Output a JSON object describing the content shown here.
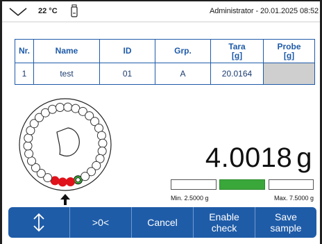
{
  "statusbar": {
    "temperature": "22 °C",
    "user_info": "Administrator - 20.01.2025 08:52"
  },
  "table": {
    "headers": [
      {
        "line1": "Nr.",
        "line2": ""
      },
      {
        "line1": "Name",
        "line2": ""
      },
      {
        "line1": "ID",
        "line2": ""
      },
      {
        "line1": "Grp.",
        "line2": ""
      },
      {
        "line1": "Tara",
        "line2": "[g]"
      },
      {
        "line1": "Probe",
        "line2": "[g]"
      }
    ],
    "rows": [
      {
        "nr": "1",
        "name": "test",
        "id": "01",
        "grp": "A",
        "tara": "20.0164",
        "probe": ""
      }
    ]
  },
  "weight": {
    "value": "4.0018",
    "unit": "g"
  },
  "tolerance": {
    "min_label": "Min. 2.5000 g",
    "max_label": "Max. 7.5000 g",
    "status": "within"
  },
  "toolbar": {
    "scroll_icon": "up-down-arrow-icon",
    "zero_label": ">0<",
    "cancel_label": "Cancel",
    "enable_check_line1": "Enable",
    "enable_check_line2": "check",
    "save_sample_line1": "Save",
    "save_sample_line2": "sample"
  },
  "rotor": {
    "positions_total": 30,
    "filled_red_positions": 3,
    "current_position_color": "#3aa73a",
    "filled_color": "#e0121b"
  },
  "colors": {
    "accent": "#1f5ca8",
    "table_header": "#1e5aa8",
    "in_tolerance": "#3aa73a"
  }
}
